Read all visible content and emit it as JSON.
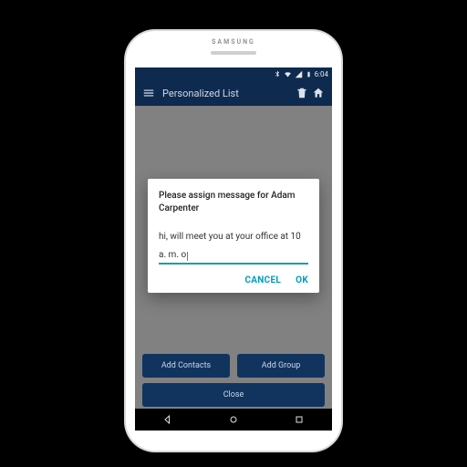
{
  "device_brand": "SAMSUNG",
  "statusbar": {
    "time": "6:04",
    "icons": [
      "bluetooth-icon",
      "wifi-icon",
      "signal-icon",
      "battery-icon"
    ]
  },
  "appbar": {
    "title": "Personalized List"
  },
  "dialog": {
    "title": "Please assign message for Adam Carpenter",
    "input_value": "hi,  will meet you at your office at 10 a. m. o",
    "cancel": "CANCEL",
    "ok": "OK"
  },
  "actions": {
    "add_contacts": "Add Contacts",
    "add_group": "Add Group",
    "close": "Close"
  }
}
